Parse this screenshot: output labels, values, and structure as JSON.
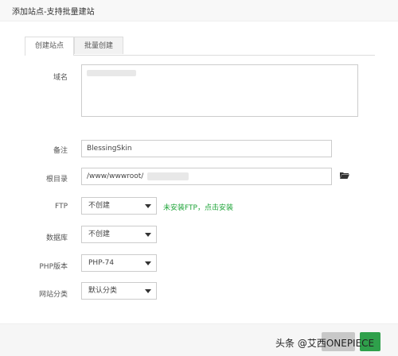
{
  "dialog": {
    "title": "添加站点-支持批量建站"
  },
  "tabs": [
    {
      "label": "创建站点",
      "active": true
    },
    {
      "label": "批量创建",
      "active": false
    }
  ],
  "form": {
    "domain_label": "域名",
    "remark_label": "备注",
    "remark_value": "BlessingSkin",
    "root_label": "根目录",
    "root_value": "/www/wwwroot/",
    "ftp_label": "FTP",
    "ftp_value": "不创建",
    "ftp_hint": "未安装FTP，点击安装",
    "db_label": "数据库",
    "db_value": "不创建",
    "php_label": "PHP版本",
    "php_value": "PHP-74",
    "category_label": "网站分类",
    "category_value": "默认分类"
  },
  "footer": {
    "cancel_label": "",
    "submit_label": "",
    "watermark": "头条 @艾西ONEPIECE"
  },
  "icons": {
    "folder": "folder-open-icon",
    "caret": "chevron-down-icon"
  },
  "colors": {
    "accent_green": "#20a53a",
    "submit_green": "#2fa04b"
  }
}
